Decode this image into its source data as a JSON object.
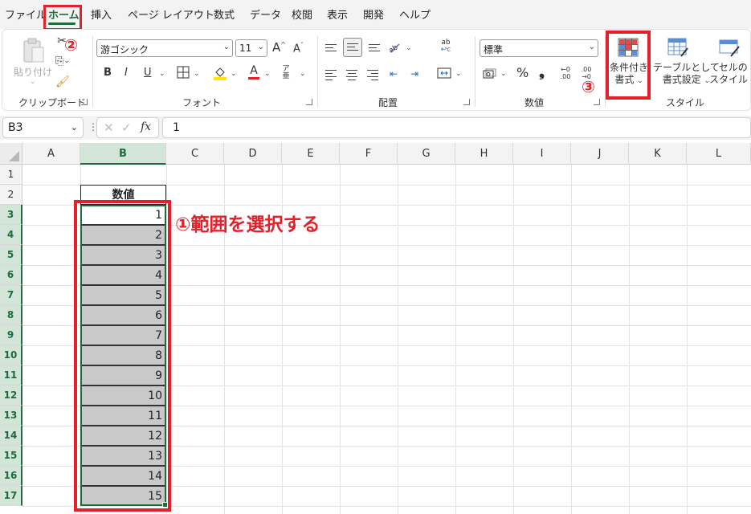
{
  "menu": {
    "tabs": [
      "ファイル",
      "ホーム",
      "挿入",
      "ページ レイアウト",
      "数式",
      "データ",
      "校閲",
      "表示",
      "開発",
      "ヘルプ"
    ],
    "active_tab": "ホーム"
  },
  "ribbon": {
    "clipboard": {
      "label": "クリップボード",
      "paste_label": "貼り付け"
    },
    "font": {
      "label": "フォント",
      "font_name": "游ゴシック",
      "font_size": "11",
      "grow": "A",
      "shrink": "A",
      "bold": "B",
      "italic": "I",
      "underline": "U",
      "font_color_letter": "A"
    },
    "alignment": {
      "label": "配置"
    },
    "number": {
      "label": "数値",
      "format": "標準",
      "percent": "%",
      "comma": "❟"
    },
    "styles": {
      "label": "スタイル",
      "conditional_line1": "条件付き",
      "conditional_line2": "書式",
      "table_line1": "テーブルとして",
      "table_line2": "書式設定",
      "cell_line1": "セルの",
      "cell_line2": "スタイル"
    }
  },
  "formula_bar": {
    "name_box": "B3",
    "fx": "fx",
    "value": "1"
  },
  "grid": {
    "columns": [
      "A",
      "B",
      "C",
      "D",
      "E",
      "F",
      "G",
      "H",
      "I",
      "J",
      "K",
      "L"
    ],
    "rows": [
      "1",
      "2",
      "3",
      "4",
      "5",
      "6",
      "7",
      "8",
      "9",
      "10",
      "11",
      "12",
      "13",
      "14",
      "15",
      "16",
      "17"
    ],
    "selected_column": "B",
    "header_cell": "数値",
    "values": [
      "1",
      "2",
      "3",
      "4",
      "5",
      "6",
      "7",
      "8",
      "9",
      "10",
      "11",
      "12",
      "13",
      "14",
      "15"
    ]
  },
  "annotations": {
    "step1": "①範囲を選択する",
    "step2": "②",
    "step3": "③"
  },
  "colors": {
    "accent": "#1e6b3c",
    "annotation": "#e4202a",
    "selection_fill": "#c9c9c9"
  }
}
